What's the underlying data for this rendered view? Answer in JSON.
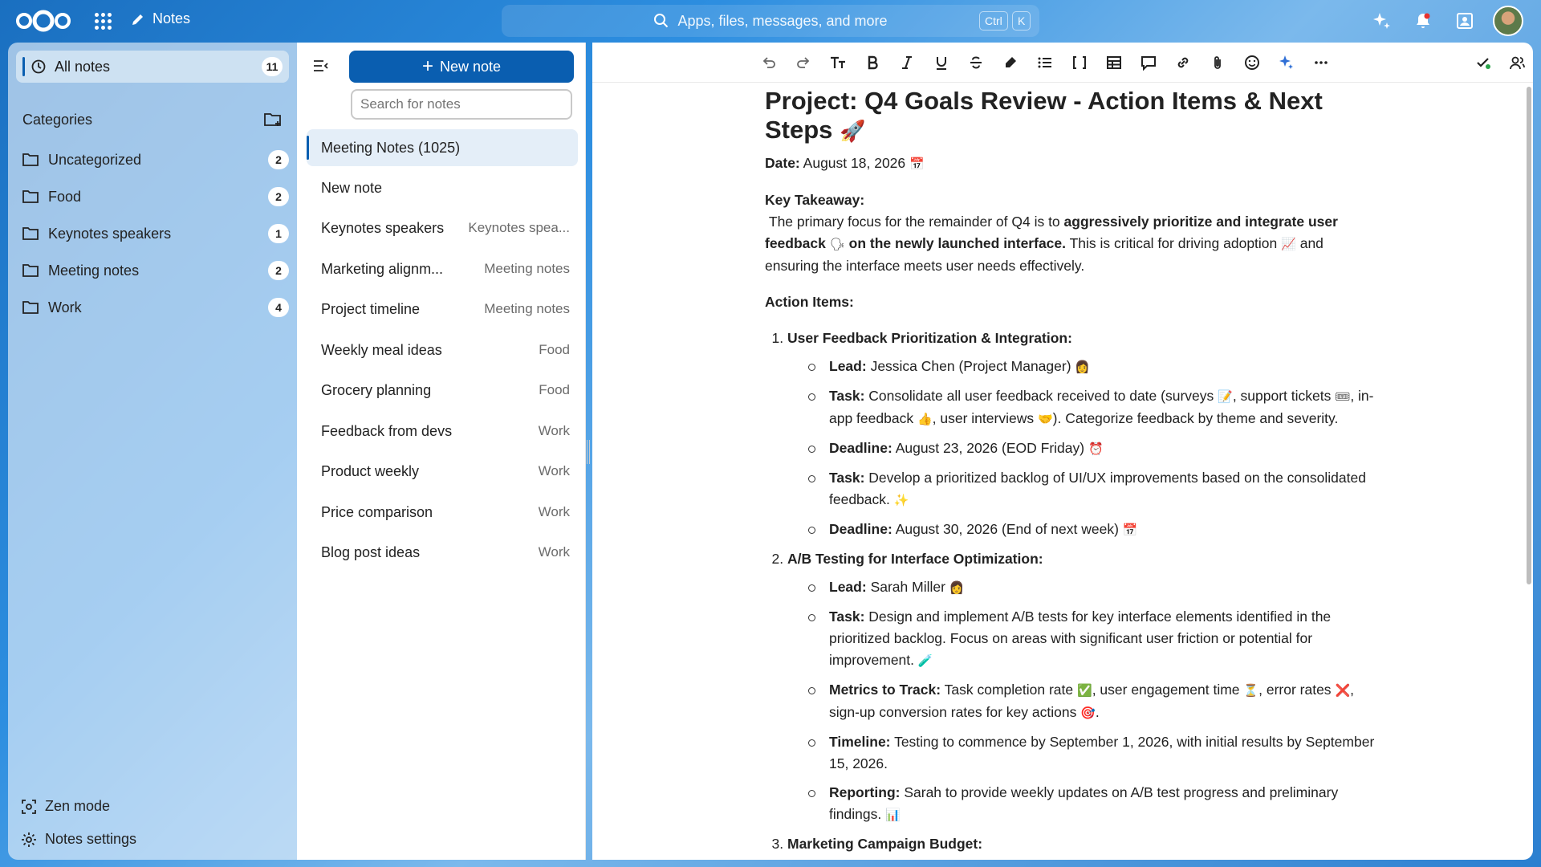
{
  "header": {
    "app_name": "Notes",
    "search_placeholder": "Apps, files, messages, and more",
    "shortcut_ctrl": "Ctrl",
    "shortcut_k": "K"
  },
  "nav": {
    "all_notes": {
      "label": "All notes",
      "count": "11"
    },
    "categories_title": "Categories",
    "categories": [
      {
        "label": "Uncategorized",
        "count": "2"
      },
      {
        "label": "Food",
        "count": "2"
      },
      {
        "label": "Keynotes speakers",
        "count": "1"
      },
      {
        "label": "Meeting notes",
        "count": "2"
      },
      {
        "label": "Work",
        "count": "4"
      }
    ],
    "zen_mode": "Zen mode",
    "settings": "Notes settings"
  },
  "list": {
    "new_note": "New note",
    "search_placeholder": "Search for notes",
    "notes": [
      {
        "title": "Meeting Notes (1025)",
        "category": ""
      },
      {
        "title": "New note",
        "category": ""
      },
      {
        "title": "Keynotes speakers",
        "category": "Keynotes spea..."
      },
      {
        "title": "Marketing alignm...",
        "category": "Meeting notes"
      },
      {
        "title": "Project timeline",
        "category": "Meeting notes"
      },
      {
        "title": "Weekly meal ideas",
        "category": "Food"
      },
      {
        "title": "Grocery planning",
        "category": "Food"
      },
      {
        "title": "Feedback from devs",
        "category": "Work"
      },
      {
        "title": "Product weekly",
        "category": "Work"
      },
      {
        "title": "Price comparison",
        "category": "Work"
      },
      {
        "title": "Blog post ideas",
        "category": "Work"
      }
    ]
  },
  "doc": {
    "title": "Project: Q4 Goals Review - Action Items & Next Steps",
    "title_emoji": "🚀",
    "date_label": "Date:",
    "date_value": "August 18, 2026",
    "takeaway_label": "Key Takeaway:",
    "takeaway_1": "The primary focus for the remainder of Q4 is to",
    "takeaway_bold": "aggressively prioritize and integrate user feedback",
    "takeaway_bold_2": "on the newly launched interface.",
    "takeaway_2": "This is critical for driving adoption",
    "takeaway_3": "and ensuring the interface meets user needs effectively.",
    "action_items_label": "Action Items:",
    "item1": {
      "head": "User Feedback Prioritization & Integration:",
      "lead_label": "Lead:",
      "lead": "Jessica Chen (Project Manager)",
      "task_label": "Task:",
      "task1_a": "Consolidate all user feedback received to date (surveys",
      "task1_b": ", support tickets",
      "task1_c": ", in-app feedback",
      "task1_d": ", user interviews",
      "task1_e": "). Categorize feedback by theme and severity.",
      "deadline_label": "Deadline:",
      "deadline1": "August 23, 2026 (EOD Friday)",
      "task2": "Develop a prioritized backlog of UI/UX improvements based on the consolidated feedback.",
      "deadline2": "August 30, 2026 (End of next week)"
    },
    "item2": {
      "head": "A/B Testing for Interface Optimization:",
      "lead_label": "Lead:",
      "lead": "Sarah Miller",
      "task_label": "Task:",
      "task": "Design and implement A/B tests for key interface elements identified in the prioritized backlog. Focus on areas with significant user friction or potential for improvement.",
      "metrics_label": "Metrics to Track:",
      "metrics_a": "Task completion rate",
      "metrics_b": ", user engagement time",
      "metrics_c": ", error rates",
      "metrics_d": ", sign-up conversion rates for key actions",
      "metrics_e": ".",
      "timeline_label": "Timeline:",
      "timeline": "Testing to commence by September 1, 2026, with initial results by September 15, 2026.",
      "reporting_label": "Reporting:",
      "reporting": "Sarah to provide weekly updates on A/B test progress and preliminary findings."
    },
    "item3": {
      "head": "Marketing Campaign Budget:"
    }
  }
}
